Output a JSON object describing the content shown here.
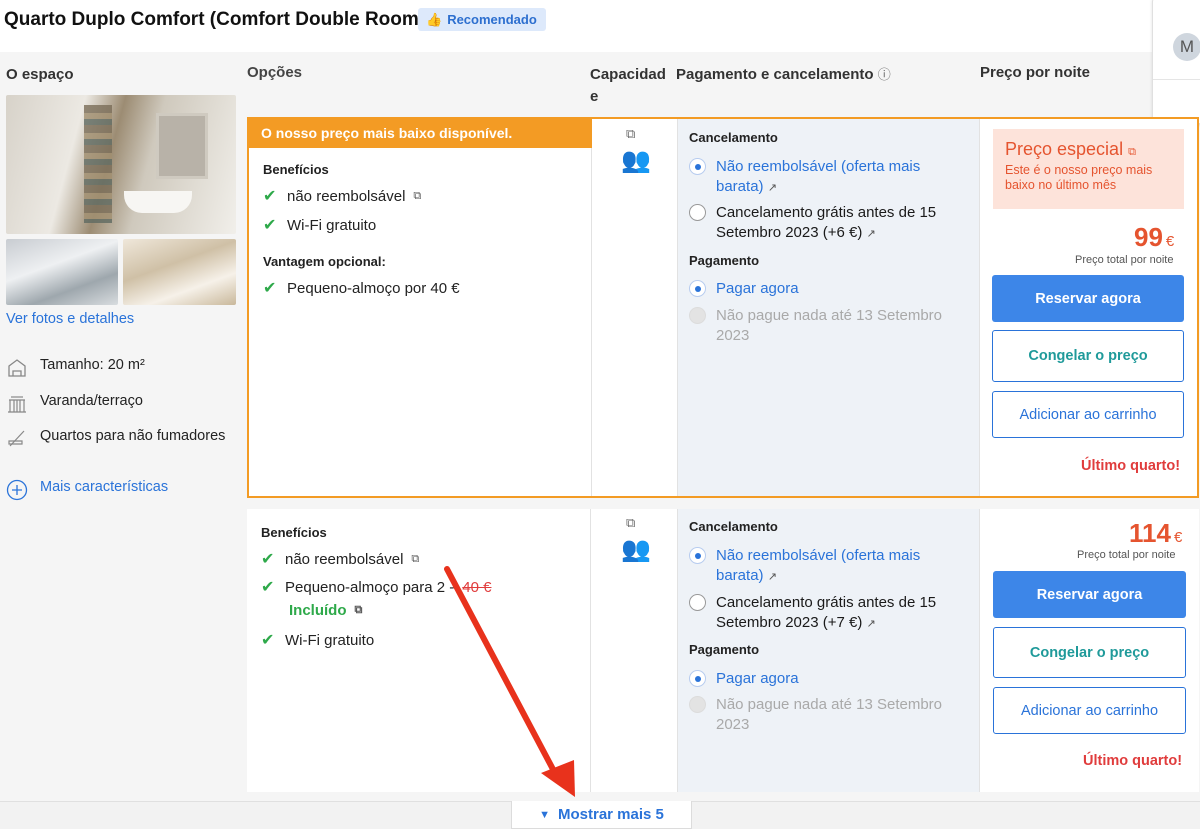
{
  "room": {
    "title": "Quarto Duplo Comfort (Comfort Double Room)",
    "badge": "Recomendado"
  },
  "user": {
    "avatar_initial": "M"
  },
  "columns": {
    "space": "O espaço",
    "options": "Opções",
    "capacity": "Capacidad\ne",
    "payment": "Pagamento e cancelamento",
    "price": "Preço por noite"
  },
  "space": {
    "photos_link": "Ver fotos e detalhes",
    "features": [
      {
        "icon": "size-icon",
        "label": "Tamanho: 20 m²"
      },
      {
        "icon": "balcony-icon",
        "label": "Varanda/terraço"
      },
      {
        "icon": "no-smoking-icon",
        "label": "Quartos para não fumadores"
      }
    ],
    "more_features": "Mais características"
  },
  "option1": {
    "banner": "O nosso preço mais baixo disponível.",
    "benefits_header": "Benefícios",
    "benefits": [
      "não reembolsável",
      "Wi-Fi gratuito"
    ],
    "optional_header": "Vantagem opcional:",
    "optional": [
      "Pequeno-almoço por 40 €"
    ],
    "cancel_header": "Cancelamento",
    "cancel_options": [
      "Não reembolsável (oferta mais barata)",
      "Cancelamento grátis antes de 15 Setembro 2023 (+6 €)"
    ],
    "pay_header": "Pagamento",
    "pay_options": [
      "Pagar agora",
      "Não pague nada até 13 Setembro 2023"
    ],
    "special_title": "Preço especial",
    "special_desc": "Este é o nosso preço mais baixo no último mês",
    "price": "99",
    "currency": "€",
    "price_note": "Preço total por noite",
    "reserve": "Reservar agora",
    "freeze": "Congelar o preço",
    "cart": "Adicionar ao carrinho",
    "last_room": "Último quarto!"
  },
  "option2": {
    "benefits_header": "Benefícios",
    "benefits": [
      "não reembolsável",
      "Pequeno-almoço para 2 -",
      "Wi-Fi gratuito"
    ],
    "breakfast_old_price": "40 €",
    "included": "Incluído",
    "cancel_header": "Cancelamento",
    "cancel_options": [
      "Não reembolsável (oferta mais barata)",
      "Cancelamento grátis antes de 15 Setembro 2023 (+7 €)"
    ],
    "pay_header": "Pagamento",
    "pay_options": [
      "Pagar agora",
      "Não pague nada até 13 Setembro 2023"
    ],
    "price": "114",
    "currency": "€",
    "price_note": "Preço total por noite",
    "reserve": "Reservar agora",
    "freeze": "Congelar o preço",
    "cart": "Adicionar ao carrinho",
    "last_room": "Último quarto!"
  },
  "show_more": "Mostrar mais 5",
  "colors": {
    "accent_orange": "#f39b24",
    "link_blue": "#2a73d9",
    "price_red": "#e5542f",
    "annotation_arrow": "#e8321c"
  }
}
